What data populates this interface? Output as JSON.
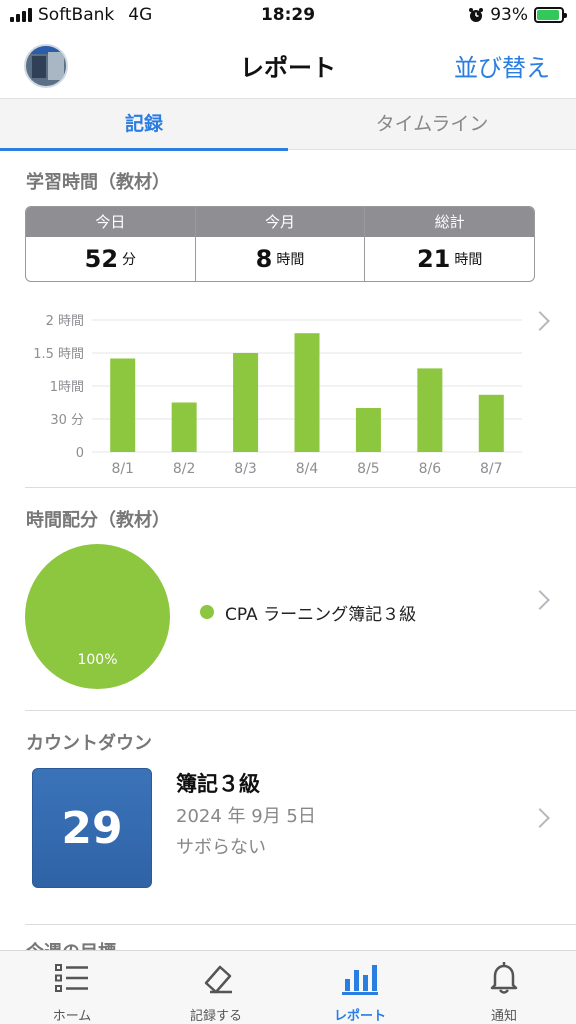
{
  "status_bar": {
    "carrier": "SoftBank",
    "network": "4G",
    "time": "18:29",
    "battery_percent": "93%",
    "battery_level": 0.93
  },
  "header": {
    "title": "レポート",
    "sort_label": "並び替え"
  },
  "tabs": [
    {
      "label": "記録",
      "active": true
    },
    {
      "label": "タイムライン",
      "active": false
    }
  ],
  "study_time": {
    "title": "学習時間（教材）",
    "stats": [
      {
        "label": "今日",
        "value": "52",
        "unit": "分"
      },
      {
        "label": "今月",
        "value": "8",
        "unit": "時間"
      },
      {
        "label": "総計",
        "value": "21",
        "unit": "時間"
      }
    ]
  },
  "chart_data": {
    "type": "bar",
    "categories": [
      "8/1",
      "8/2",
      "8/3",
      "8/4",
      "8/5",
      "8/6",
      "8/7"
    ],
    "values": [
      85,
      45,
      90,
      108,
      40,
      76,
      52
    ],
    "y_ticks": [
      {
        "value": 0,
        "label": "0"
      },
      {
        "value": 30,
        "label": "30 分"
      },
      {
        "value": 60,
        "label": "1時間"
      },
      {
        "value": 90,
        "label": "1.5 時間"
      },
      {
        "value": 120,
        "label": "2 時間"
      }
    ],
    "ylim": [
      0,
      120
    ],
    "bar_color": "#8dc63f",
    "grid": true
  },
  "time_distribution": {
    "title": "時間配分（教材）",
    "pie_color": "#8dc63f",
    "slices": [
      {
        "label": "CPA ラーニング簿記３級",
        "percent": 100,
        "percent_label": "100%"
      }
    ]
  },
  "countdown": {
    "title": "カウントダウン",
    "days": "29",
    "event_name": "簿記３級",
    "date": "2024 年 9月 5日",
    "note": "サボらない"
  },
  "next_section_title": "今週の目標",
  "bottom_nav": [
    {
      "label": "ホーム",
      "icon": "list-icon",
      "active": false
    },
    {
      "label": "記録する",
      "icon": "pencil-icon",
      "active": false
    },
    {
      "label": "レポート",
      "icon": "bar-chart-icon",
      "active": true
    },
    {
      "label": "通知",
      "icon": "bell-icon",
      "active": false
    }
  ],
  "colors": {
    "accent": "#2a7de1",
    "bar": "#8dc63f",
    "countdown_box": "#3069af"
  }
}
